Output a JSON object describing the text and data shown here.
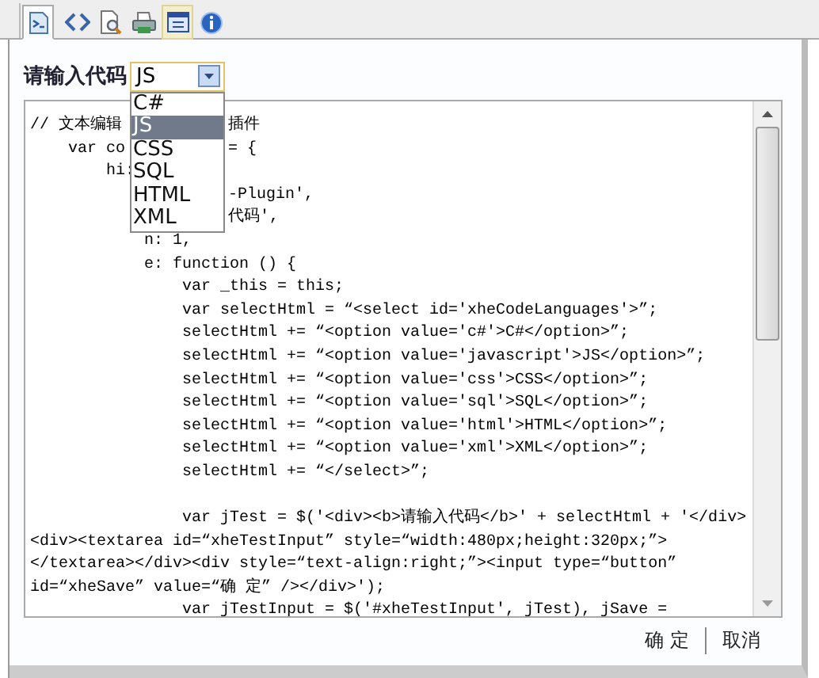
{
  "toolbar": {
    "buttons": [
      {
        "kind": "page",
        "selected": true,
        "highlighted": false
      },
      {
        "kind": "code",
        "selected": false,
        "highlighted": false
      },
      {
        "kind": "preview",
        "selected": false,
        "highlighted": false
      },
      {
        "kind": "print",
        "selected": false,
        "highlighted": false
      },
      {
        "kind": "window",
        "selected": false,
        "highlighted": true
      },
      {
        "kind": "info",
        "selected": false,
        "highlighted": false
      }
    ]
  },
  "dialog": {
    "label": "请输入代码",
    "select": {
      "value": "JS",
      "open": true,
      "options": [
        {
          "label": "C#",
          "selected": false
        },
        {
          "label": "JS",
          "selected": true
        },
        {
          "label": "CSS",
          "selected": false
        },
        {
          "label": "SQL",
          "selected": false
        },
        {
          "label": "HTML",
          "selected": false
        },
        {
          "label": "XML",
          "selected": false
        }
      ]
    },
    "code_lines": [
      {
        "text": "// 文本编辑",
        "text_after": "插件"
      },
      {
        "text": "    var co",
        "text_after": "= {"
      },
      {
        "text": "        hi:"
      },
      {
        "text_after": "-Plugin',"
      },
      {
        "text_after": "代码',"
      },
      {
        "text": "            n: 1,"
      },
      {
        "text": "            e: function () {"
      },
      {
        "text": "                var _this = this;"
      },
      {
        "text": "                var selectHtml = “<select id='xheCodeLanguages'>”;"
      },
      {
        "text": "                selectHtml += “<option value='c#'>C#</option>”;"
      },
      {
        "text": "                selectHtml += “<option value='javascript'>JS</option>”;"
      },
      {
        "text": "                selectHtml += “<option value='css'>CSS</option>”;"
      },
      {
        "text": "                selectHtml += “<option value='sql'>SQL</option>”;"
      },
      {
        "text": "                selectHtml += “<option value='html'>HTML</option>”;"
      },
      {
        "text": "                selectHtml += “<option value='xml'>XML</option>”;"
      },
      {
        "text": "                selectHtml += “</select>”;"
      },
      {
        "gap_before": true,
        "text": "                var jTest = $('<div><b>请输入代码</b>' + selectHtml + '</div>"
      },
      {
        "text": "<div><textarea id=“xheTestInput” style=“width:480px;height:320px;”>"
      },
      {
        "text": "</textarea></div><div style=“text-align:right;”><input type=“button”"
      },
      {
        "text": "id=“xheSave” value=“确 定” /></div>');"
      },
      {
        "text": "                var jTestInput = $('#xheTestInput', jTest), jSave ="
      }
    ],
    "buttons": [
      "确 定",
      "取消"
    ]
  }
}
